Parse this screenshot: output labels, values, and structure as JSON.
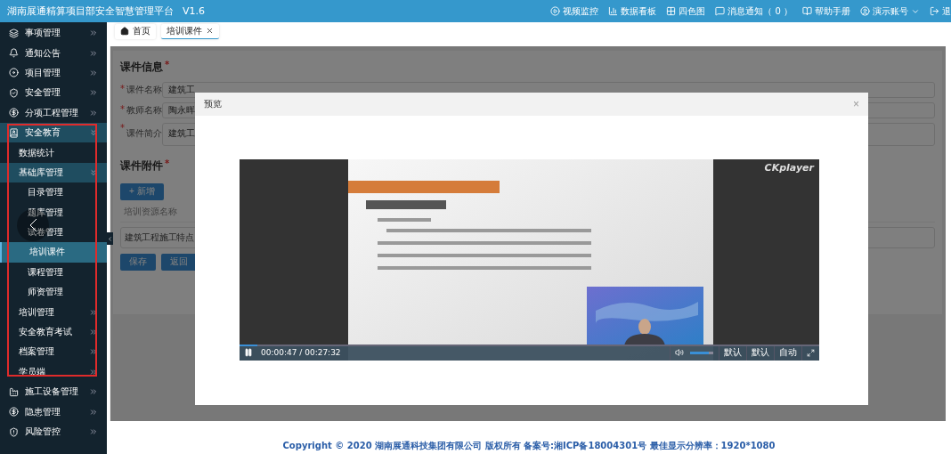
{
  "header": {
    "title": "湖南展通精算项目部安全智慧管理平台",
    "version": "V1.6",
    "nav": [
      {
        "label": "视频监控"
      },
      {
        "label": "数据看板"
      },
      {
        "label": "四色图"
      },
      {
        "label": "消息通知（ 0 ）"
      },
      {
        "label": "帮助手册"
      }
    ],
    "user": "演示账号",
    "logout": "退"
  },
  "sidebar": {
    "items": [
      {
        "label": "事项管理",
        "expanded": false,
        "selected": false
      },
      {
        "label": "通知公告",
        "expanded": false,
        "selected": false
      },
      {
        "label": "项目管理",
        "expanded": false,
        "selected": false
      },
      {
        "label": "安全管理",
        "expanded": false,
        "selected": false
      },
      {
        "label": "分项工程管理",
        "expanded": false,
        "selected": false
      },
      {
        "label": "安全教育",
        "expanded": true,
        "selected": false,
        "children": [
          {
            "label": "数据统计",
            "selected": false
          },
          {
            "label": "基础库管理",
            "expanded": true,
            "selected": false,
            "children": [
              {
                "label": "目录管理",
                "selected": false
              },
              {
                "label": "题库管理",
                "selected": false
              },
              {
                "label": "试卷管理",
                "selected": false
              },
              {
                "label": "培训课件",
                "selected": true
              },
              {
                "label": "课程管理",
                "selected": false
              },
              {
                "label": "师资管理",
                "selected": false
              }
            ]
          },
          {
            "label": "培训管理",
            "expanded": false,
            "selected": false
          },
          {
            "label": "安全教育考试",
            "expanded": false,
            "selected": false
          },
          {
            "label": "档案管理",
            "expanded": false,
            "selected": false
          },
          {
            "label": "学员端",
            "expanded": false,
            "selected": false
          }
        ]
      },
      {
        "label": "施工设备管理",
        "expanded": false,
        "selected": false
      },
      {
        "label": "隐患管理",
        "expanded": false,
        "selected": false
      },
      {
        "label": "风险管控",
        "expanded": false,
        "selected": false
      }
    ]
  },
  "tabs": [
    {
      "label": "首页",
      "selected": false,
      "closable": false
    },
    {
      "label": "培训课件",
      "selected": true,
      "closable": true
    }
  ],
  "form": {
    "info_title": "课件信息",
    "info_mark": "*",
    "fields": [
      {
        "label": "课件名称",
        "mark": "*",
        "value": "建筑工",
        "kind": "input"
      },
      {
        "label": "教师名称",
        "mark": "*",
        "value": "陶永晖",
        "kind": "input"
      },
      {
        "label": "课件简介",
        "mark": "*",
        "value": "建筑工",
        "kind": "textarea"
      }
    ],
    "attach_title": "课件附件",
    "attach_mark": "*",
    "add_button": "+ 新增",
    "column": "培训资源名称",
    "rows": [
      "建筑工程施工特点"
    ],
    "buttons": [
      "保存",
      "返回"
    ]
  },
  "modal": {
    "title": "预览",
    "close": "×",
    "player": {
      "brand": "CKplayer",
      "playing": true,
      "time": "00:00:47 / 00:27:32",
      "progress": {
        "level": 0.03
      },
      "volume": {
        "level": 0.8
      },
      "options": [
        "默认",
        "默认",
        "自动"
      ]
    }
  },
  "footer": "Copyright © 2020 湖南展通科技集团有限公司 版权所有 备案号:湘ICP备18004301号 最佳显示分辨率：1920*1080"
}
